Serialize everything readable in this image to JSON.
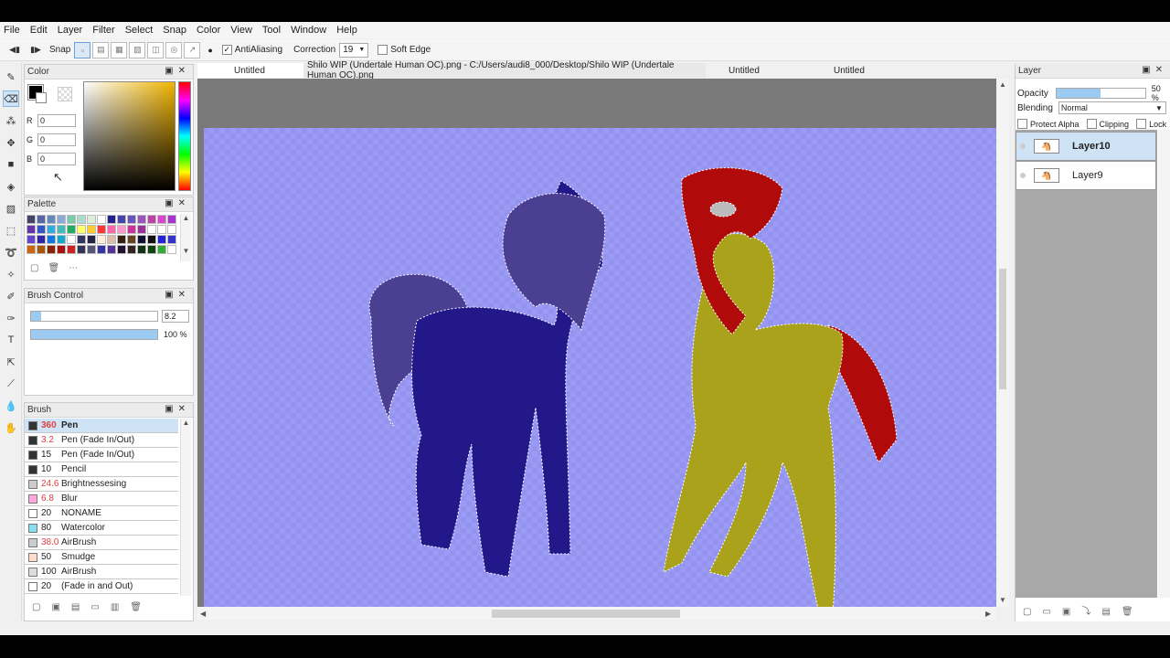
{
  "menu": [
    "File",
    "Edit",
    "Layer",
    "Filter",
    "Select",
    "Snap",
    "Color",
    "View",
    "Tool",
    "Window",
    "Help"
  ],
  "toolbar": {
    "snap_label": "Snap",
    "antialiasing_label": "AntiAliasing",
    "antialiasing_checked": true,
    "correction_label": "Correction",
    "correction_value": "19",
    "softedge_label": "Soft Edge",
    "softedge_checked": false
  },
  "color_panel": {
    "title": "Color",
    "r_label": "R",
    "r_value": "0",
    "g_label": "G",
    "g_value": "0",
    "b_label": "B",
    "b_value": "0",
    "foreground": "#000000"
  },
  "palette_panel": {
    "title": "Palette",
    "swatches": [
      "#444466",
      "#5566aa",
      "#6688bb",
      "#88aadd",
      "#77ccaa",
      "#aaddcc",
      "#ddeedd",
      "#ffffff",
      "#222288",
      "#4444aa",
      "#6655bb",
      "#9955bb",
      "#bb44aa",
      "#dd44cc",
      "#aa33cc",
      "#6633aa",
      "#3355cc",
      "#33aadd",
      "#44bbbb",
      "#22aa66",
      "#ffff66",
      "#ffcc33",
      "#ff3333",
      "#ff66aa",
      "#ff99cc",
      "#cc3399",
      "#993399",
      "#ffffff",
      "#ffffff",
      "#ffffff",
      "#6644cc",
      "#3322aa",
      "#1177dd",
      "#11aacc",
      "#ffffff",
      "#333366",
      "#222244",
      "#ffeedd",
      "#ddbbaa",
      "#332211",
      "#664422",
      "#111133",
      "#111111",
      "#2222dd",
      "#3333cc",
      "#cc6611",
      "#aa5500",
      "#882200",
      "#aa1111",
      "#cc2222",
      "#333355",
      "#555577",
      "#3333aa",
      "#553399",
      "#221133",
      "#332222",
      "#113311",
      "#114411",
      "#33aa33",
      "#ffffff"
    ]
  },
  "brush_control": {
    "title": "Brush Control",
    "size_value": "8.2",
    "size_fraction": 0.08,
    "opacity_value": "100 %",
    "opacity_fraction": 1.0
  },
  "brush_panel": {
    "title": "Brush",
    "items": [
      {
        "size": "360",
        "name": "Pen",
        "color": "#333333",
        "size_red": true
      },
      {
        "size": "3.2",
        "name": "Pen (Fade In/Out)",
        "color": "#333333",
        "size_red": true
      },
      {
        "size": "15",
        "name": "Pen (Fade In/Out)",
        "color": "#333333",
        "size_red": false
      },
      {
        "size": "10",
        "name": "Pencil",
        "color": "#333333",
        "size_red": false
      },
      {
        "size": "24.6",
        "name": "Brightnessesing",
        "color": "#cccccc",
        "size_red": true
      },
      {
        "size": "6.8",
        "name": "Blur",
        "color": "#ffaadd",
        "size_red": true
      },
      {
        "size": "20",
        "name": "NONAME",
        "color": "#ffffff",
        "size_red": false
      },
      {
        "size": "80",
        "name": "Watercolor",
        "color": "#88ddee",
        "size_red": false
      },
      {
        "size": "38.0",
        "name": "AirBrush",
        "color": "#cccccc",
        "size_red": true
      },
      {
        "size": "50",
        "name": "Smudge",
        "color": "#ffddcc",
        "size_red": false
      },
      {
        "size": "100",
        "name": "AirBrush",
        "color": "#dddddd",
        "size_red": false
      },
      {
        "size": "20",
        "name": "(Fade in and Out)",
        "color": "#ffffff",
        "size_red": false
      }
    ]
  },
  "tabs": [
    {
      "label": "Untitled",
      "active": true
    },
    {
      "label": "Shilo WIP (Undertale Human OC).png - C:/Users/audi8_000/Desktop/Shilo WIP (Undertale Human OC).png",
      "active": false
    },
    {
      "label": "Untitled",
      "active": false
    },
    {
      "label": "Untitled",
      "active": false
    }
  ],
  "layer_panel": {
    "title": "Layer",
    "opacity_label": "Opacity",
    "opacity_value": "50 %",
    "blending_label": "Blending",
    "blending_value": "Normal",
    "protect_alpha_label": "Protect Alpha",
    "clipping_label": "Clipping",
    "lock_label": "Lock",
    "layers": [
      {
        "name": "Layer10",
        "selected": true
      },
      {
        "name": "Layer9",
        "selected": false
      }
    ]
  },
  "colors": {
    "canvas_bg": "#9b9bf5",
    "pony_left_body": "#22188a",
    "pony_left_mane": "#4a3f90",
    "pony_right_body": "#a9a21a",
    "pony_right_mane": "#b00a0a"
  }
}
